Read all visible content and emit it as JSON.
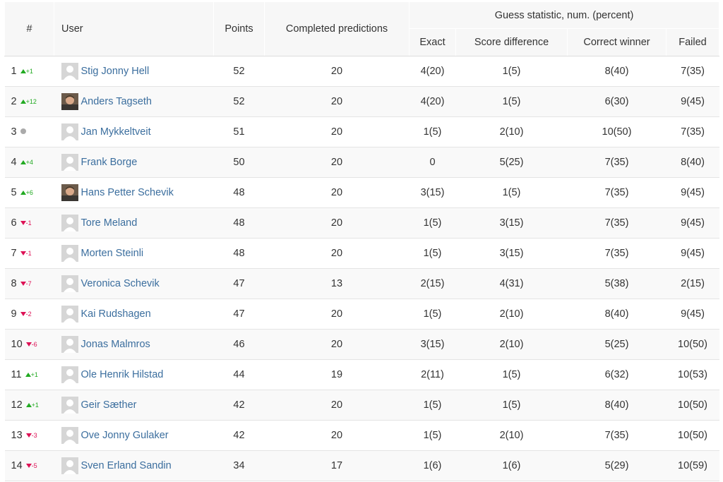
{
  "columns": {
    "rank": "#",
    "user": "User",
    "points": "Points",
    "completed": "Completed predictions",
    "stats_group": "Guess statistic, num. (percent)",
    "exact": "Exact",
    "score_diff": "Score difference",
    "correct_winner": "Correct winner",
    "failed": "Failed"
  },
  "colors": {
    "up": "#22aa22",
    "down": "#dd1155",
    "same": "#aaaaaa",
    "link": "#3b6e9e"
  },
  "rows": [
    {
      "rank": "1",
      "trend": "up",
      "trend_text": "+1",
      "avatar": "placeholder",
      "name": "Stig Jonny Hell",
      "points": "52",
      "completed": "20",
      "exact": "4(20)",
      "score_diff": "1(5)",
      "correct_winner": "8(40)",
      "failed": "7(35)"
    },
    {
      "rank": "2",
      "trend": "up",
      "trend_text": "+12",
      "avatar": "photo",
      "name": "Anders Tagseth",
      "points": "52",
      "completed": "20",
      "exact": "4(20)",
      "score_diff": "1(5)",
      "correct_winner": "6(30)",
      "failed": "9(45)"
    },
    {
      "rank": "3",
      "trend": "same",
      "trend_text": "",
      "avatar": "placeholder",
      "name": "Jan Mykkeltveit",
      "points": "51",
      "completed": "20",
      "exact": "1(5)",
      "score_diff": "2(10)",
      "correct_winner": "10(50)",
      "failed": "7(35)"
    },
    {
      "rank": "4",
      "trend": "up",
      "trend_text": "+4",
      "avatar": "placeholder",
      "name": "Frank Borge",
      "points": "50",
      "completed": "20",
      "exact": "0",
      "score_diff": "5(25)",
      "correct_winner": "7(35)",
      "failed": "8(40)"
    },
    {
      "rank": "5",
      "trend": "up",
      "trend_text": "+6",
      "avatar": "photo",
      "name": "Hans Petter Schevik",
      "points": "48",
      "completed": "20",
      "exact": "3(15)",
      "score_diff": "1(5)",
      "correct_winner": "7(35)",
      "failed": "9(45)"
    },
    {
      "rank": "6",
      "trend": "down",
      "trend_text": "-1",
      "avatar": "placeholder",
      "name": "Tore Meland",
      "points": "48",
      "completed": "20",
      "exact": "1(5)",
      "score_diff": "3(15)",
      "correct_winner": "7(35)",
      "failed": "9(45)"
    },
    {
      "rank": "7",
      "trend": "down",
      "trend_text": "-1",
      "avatar": "placeholder",
      "name": "Morten Steinli",
      "points": "48",
      "completed": "20",
      "exact": "1(5)",
      "score_diff": "3(15)",
      "correct_winner": "7(35)",
      "failed": "9(45)"
    },
    {
      "rank": "8",
      "trend": "down",
      "trend_text": "-7",
      "avatar": "placeholder",
      "name": "Veronica Schevik",
      "points": "47",
      "completed": "13",
      "exact": "2(15)",
      "score_diff": "4(31)",
      "correct_winner": "5(38)",
      "failed": "2(15)"
    },
    {
      "rank": "9",
      "trend": "down",
      "trend_text": "-2",
      "avatar": "placeholder",
      "name": "Kai Rudshagen",
      "points": "47",
      "completed": "20",
      "exact": "1(5)",
      "score_diff": "2(10)",
      "correct_winner": "8(40)",
      "failed": "9(45)"
    },
    {
      "rank": "10",
      "trend": "down",
      "trend_text": "-6",
      "avatar": "placeholder",
      "name": "Jonas Malmros",
      "points": "46",
      "completed": "20",
      "exact": "3(15)",
      "score_diff": "2(10)",
      "correct_winner": "5(25)",
      "failed": "10(50)"
    },
    {
      "rank": "11",
      "trend": "up",
      "trend_text": "+1",
      "avatar": "placeholder",
      "name": "Ole Henrik Hilstad",
      "points": "44",
      "completed": "19",
      "exact": "2(11)",
      "score_diff": "1(5)",
      "correct_winner": "6(32)",
      "failed": "10(53)"
    },
    {
      "rank": "12",
      "trend": "up",
      "trend_text": "+1",
      "avatar": "placeholder",
      "name": "Geir Sæther",
      "points": "42",
      "completed": "20",
      "exact": "1(5)",
      "score_diff": "1(5)",
      "correct_winner": "8(40)",
      "failed": "10(50)"
    },
    {
      "rank": "13",
      "trend": "down",
      "trend_text": "-3",
      "avatar": "placeholder",
      "name": "Ove Jonny Gulaker",
      "points": "42",
      "completed": "20",
      "exact": "1(5)",
      "score_diff": "2(10)",
      "correct_winner": "7(35)",
      "failed": "10(50)"
    },
    {
      "rank": "14",
      "trend": "down",
      "trend_text": "-5",
      "avatar": "placeholder",
      "name": "Sven Erland Sandin",
      "points": "34",
      "completed": "17",
      "exact": "1(6)",
      "score_diff": "1(6)",
      "correct_winner": "5(29)",
      "failed": "10(59)"
    }
  ]
}
